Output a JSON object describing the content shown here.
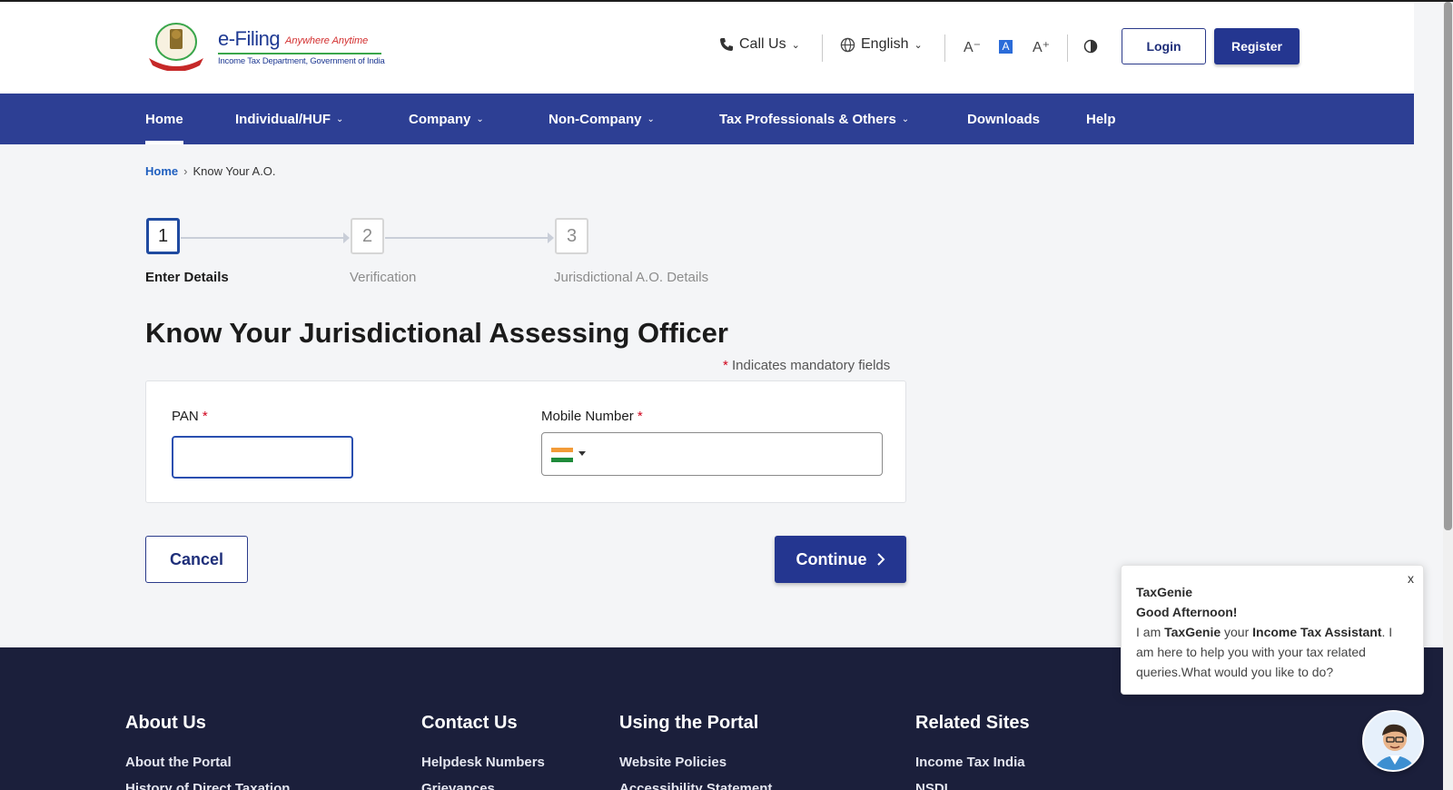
{
  "header": {
    "logo_title": "e-Filing",
    "logo_tagline": "Anywhere Anytime",
    "logo_subtitle": "Income Tax Department, Government of India",
    "call_us": "Call Us",
    "language": "English",
    "font_decrease": "A⁻",
    "font_normal": "A",
    "font_increase": "A⁺",
    "login": "Login",
    "register": "Register"
  },
  "nav": {
    "items": [
      {
        "label": "Home"
      },
      {
        "label": "Individual/HUF"
      },
      {
        "label": "Company"
      },
      {
        "label": "Non-Company"
      },
      {
        "label": "Tax Professionals & Others"
      },
      {
        "label": "Downloads"
      },
      {
        "label": "Help"
      }
    ]
  },
  "breadcrumb": {
    "home": "Home",
    "separator": "›",
    "current": "Know Your A.O."
  },
  "stepper": {
    "steps": [
      {
        "number": "1",
        "label": "Enter Details"
      },
      {
        "number": "2",
        "label": "Verification"
      },
      {
        "number": "3",
        "label": "Jurisdictional A.O. Details"
      }
    ]
  },
  "page": {
    "title": "Know Your Jurisdictional Assessing Officer",
    "mandatory_note": "Indicates mandatory fields",
    "required_mark": "*"
  },
  "form": {
    "pan_label": "PAN",
    "pan_value": "",
    "mobile_label": "Mobile Number",
    "mobile_value": "",
    "country_flag": "india-flag-icon"
  },
  "actions": {
    "cancel": "Cancel",
    "continue": "Continue"
  },
  "footer": {
    "columns": [
      {
        "title": "About Us",
        "links": [
          "About the Portal",
          "History of Direct Taxation"
        ]
      },
      {
        "title": "Contact Us",
        "links": [
          "Helpdesk Numbers",
          "Grievances"
        ]
      },
      {
        "title": "Using the Portal",
        "links": [
          "Website Policies",
          "Accessibility Statement"
        ]
      },
      {
        "title": "Related Sites",
        "links": [
          "Income Tax India",
          "NSDL"
        ]
      }
    ]
  },
  "chat": {
    "close": "x",
    "name": "TaxGenie",
    "greeting": "Good Afternoon!",
    "intro_1": "I am ",
    "bot_name": "TaxGenie",
    "intro_2": " your ",
    "assistant": "Income Tax Assistant",
    "intro_3": ". I am here to help you with your tax related queries.What would you like to do?"
  },
  "colors": {
    "primary": "#2d3f94",
    "button": "#243690",
    "footer": "#1b1f3b",
    "required": "#d0021b",
    "link": "#1f5fbf"
  }
}
